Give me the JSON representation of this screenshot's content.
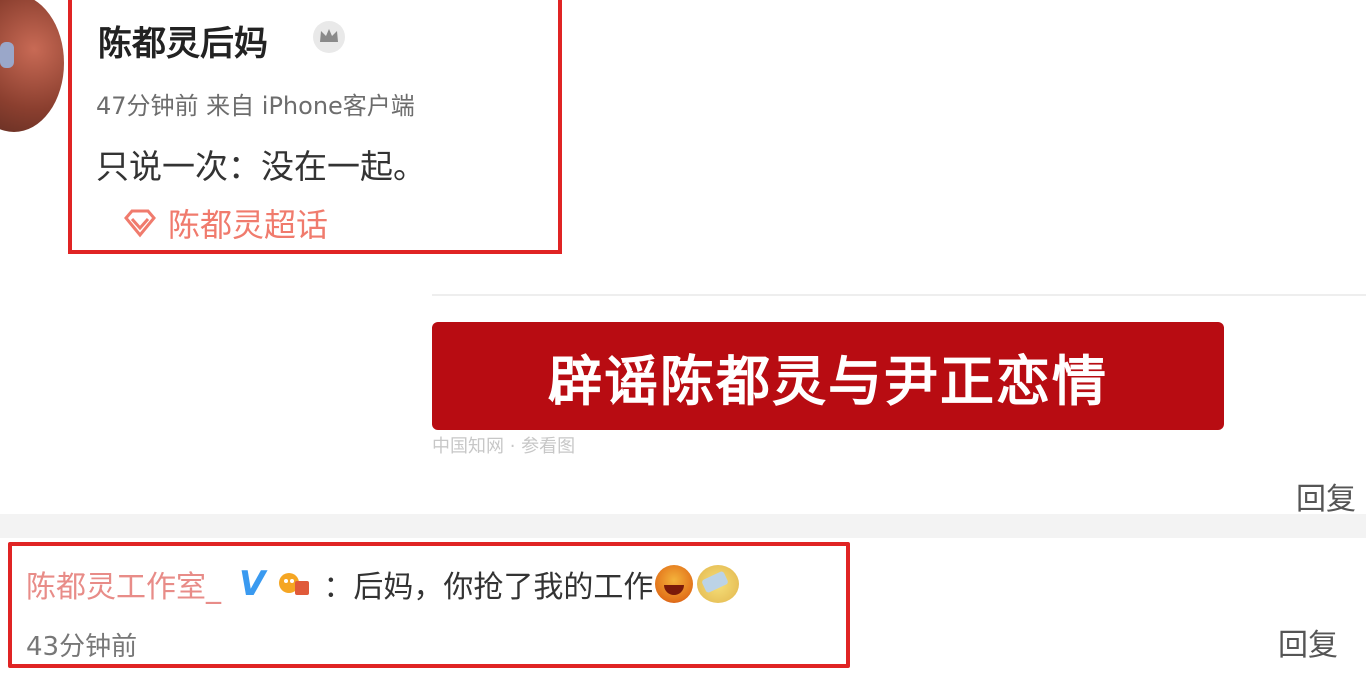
{
  "post": {
    "username": "陈都灵后妈",
    "meta": "47分钟前 来自 iPhone客户端",
    "text": "只说一次：没在一起。",
    "supertopic": "陈都灵超话",
    "icons": {
      "avatar": "avatar",
      "crown": "crown-icon",
      "supertopic": "diamond-icon"
    }
  },
  "banner": {
    "text": "辟谣陈都灵与尹正恋情"
  },
  "ghost": {
    "text": "中国知网 · 参看图"
  },
  "reply_labels": {
    "top": "回复",
    "bottom": "回复"
  },
  "comment": {
    "username": "陈都灵工作室_",
    "verified_mark": "V",
    "text": "：后妈，你抢了我的工作",
    "time": "43分钟前",
    "icons": {
      "verified": "verified-v-icon",
      "badge": "fan-badge-icon",
      "emoji1": "laughing-emoji",
      "emoji2": "tearful-emoji"
    }
  },
  "colors": {
    "highlight": "#e02424",
    "banner": "#b80c12",
    "link": "#f07b6d",
    "verified": "#3a9af0"
  }
}
